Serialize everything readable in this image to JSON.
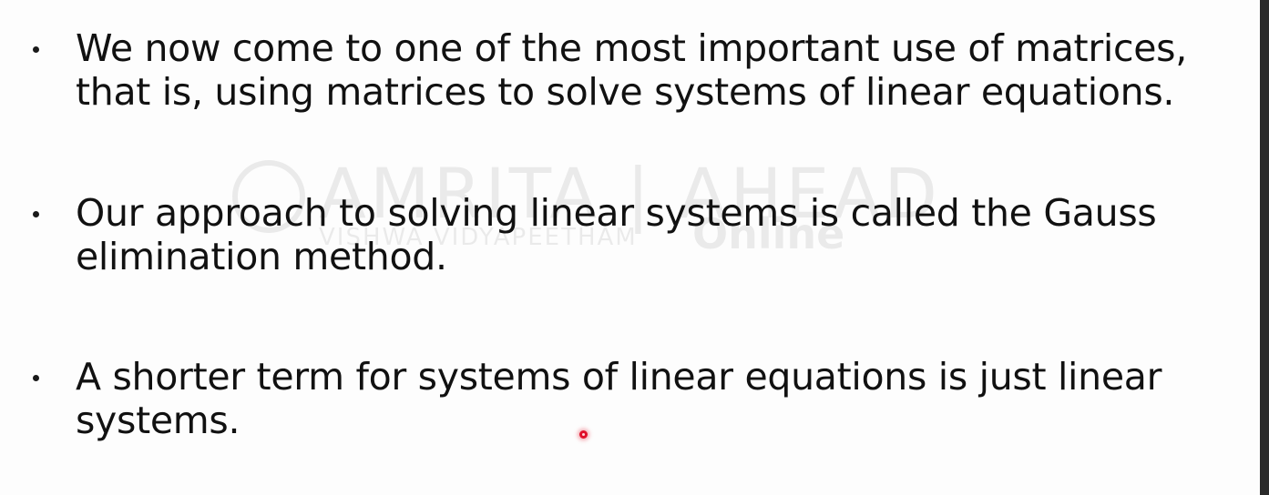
{
  "watermark": {
    "brand": "AMRITA | AHEAD",
    "subtitle": "VISHWA VIDYAPEETHAM",
    "online": "Online"
  },
  "bullets": [
    {
      "text": "We now come to one of the most important use of matrices, that is, using matrices to solve systems of linear equations."
    },
    {
      "text": "Our approach to solving linear systems is called the Gauss elimination method."
    },
    {
      "text": "A shorter term for systems of linear equations is just linear systems."
    }
  ],
  "colors": {
    "text": "#111111",
    "pointer": "#e0102a",
    "background": "#fdfdfd"
  }
}
